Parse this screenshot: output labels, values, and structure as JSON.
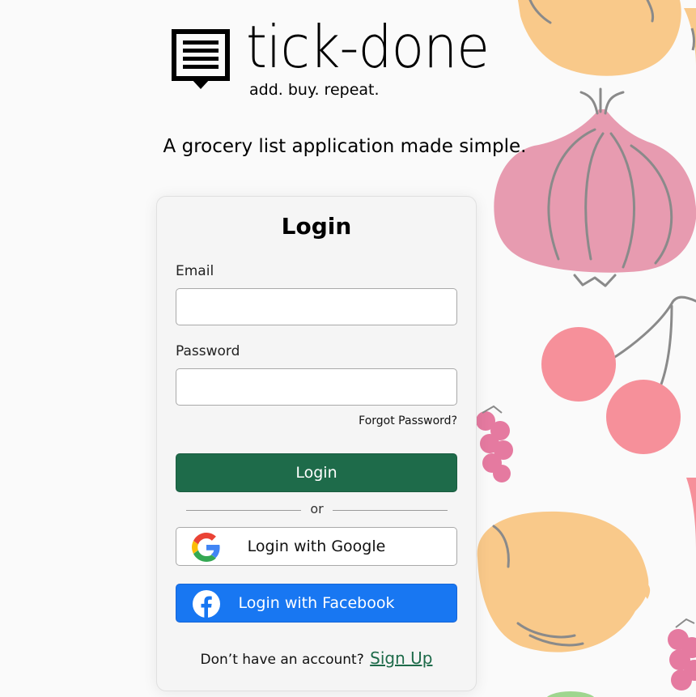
{
  "brand": {
    "name": "tick-done",
    "tagline": "add. buy. repeat.",
    "logo_icon": "notepad-speech-bubble-icon"
  },
  "subtitle": "A grocery list application made simple.",
  "login_card": {
    "title": "Login",
    "email": {
      "label": "Email",
      "value": "",
      "placeholder": ""
    },
    "password": {
      "label": "Password",
      "value": "",
      "placeholder": ""
    },
    "forgot_password": "Forgot Password?",
    "login_button": "Login",
    "divider_text": "or",
    "google_button": {
      "label": "Login with Google",
      "icon": "google-icon"
    },
    "facebook_button": {
      "label": "Login with Facebook",
      "icon": "facebook-icon"
    },
    "signup_prompt": "Don’t have an account?",
    "signup_link": "Sign Up"
  },
  "colors": {
    "primary_green": "#1e6b4a",
    "facebook_blue": "#1877f2",
    "card_background": "#f5f5f5",
    "page_background": "#fafafa"
  },
  "decorations": [
    "lemon-illustration",
    "onion-illustration",
    "cherries-illustration",
    "raspberry-illustration",
    "lemon-illustration",
    "raspberry-illustration"
  ]
}
